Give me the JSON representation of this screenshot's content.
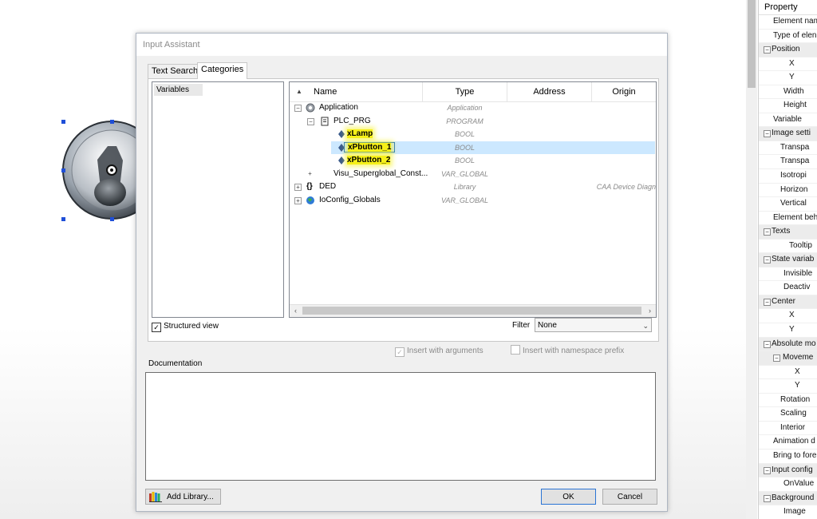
{
  "dialog": {
    "title": "Input Assistant",
    "tabs": [
      {
        "label": "Text Search",
        "active": false
      },
      {
        "label": "Categories",
        "active": true
      }
    ],
    "categories": [
      "Variables"
    ],
    "columns": {
      "name": "Name",
      "type": "Type",
      "address": "Address",
      "origin": "Origin"
    },
    "tree": [
      {
        "name": "Application",
        "type": "Application",
        "origin": ""
      },
      {
        "name": "PLC_PRG",
        "type": "PROGRAM",
        "origin": ""
      },
      {
        "name": "xLamp",
        "type": "BOOL",
        "origin": ""
      },
      {
        "name": "xPbutton_1",
        "type": "BOOL",
        "origin": ""
      },
      {
        "name": "xPbutton_2",
        "type": "BOOL",
        "origin": ""
      },
      {
        "name": "Visu_Superglobal_Const...",
        "type": "VAR_GLOBAL",
        "origin": ""
      },
      {
        "name": "DED",
        "type": "Library",
        "origin": "CAA Device Diagn"
      },
      {
        "name": "IoConfig_Globals",
        "type": "VAR_GLOBAL",
        "origin": ""
      }
    ],
    "structured_view_label": "Structured view",
    "filter_label": "Filter",
    "filter_value": "None",
    "insert_with_arguments": "Insert with arguments",
    "insert_with_namespace": "Insert with namespace prefix",
    "documentation_label": "Documentation",
    "add_library_label": "Add Library...",
    "ok_label": "OK",
    "cancel_label": "Cancel"
  },
  "property_grid": {
    "header": "Property",
    "rows": [
      {
        "label": "Element nam",
        "group": false
      },
      {
        "label": "Type of elen",
        "group": false
      },
      {
        "label": "Position",
        "group": true
      },
      {
        "label": "X",
        "group": false
      },
      {
        "label": "Y",
        "group": false
      },
      {
        "label": "Width",
        "group": false
      },
      {
        "label": "Height",
        "group": false
      },
      {
        "label": "Variable",
        "group": false
      },
      {
        "label": "Image setti",
        "group": true
      },
      {
        "label": "Transpa",
        "group": false
      },
      {
        "label": "Transpa",
        "group": false
      },
      {
        "label": "Isotropi",
        "group": false
      },
      {
        "label": "Horizon",
        "group": false
      },
      {
        "label": "Vertical",
        "group": false
      },
      {
        "label": "Element beh",
        "group": false
      },
      {
        "label": "Texts",
        "group": true
      },
      {
        "label": "Tooltip",
        "group": false
      },
      {
        "label": "State variab",
        "group": true
      },
      {
        "label": "Invisible",
        "group": false
      },
      {
        "label": "Deactiv",
        "group": false
      },
      {
        "label": "Center",
        "group": true
      },
      {
        "label": "X",
        "group": false
      },
      {
        "label": "Y",
        "group": false
      },
      {
        "label": "Absolute mo",
        "group": true
      },
      {
        "label": "Moveme",
        "group": true
      },
      {
        "label": "X",
        "group": false
      },
      {
        "label": "Y",
        "group": false
      },
      {
        "label": "Rotation",
        "group": false
      },
      {
        "label": "Scaling",
        "group": false
      },
      {
        "label": "Interior",
        "group": false
      },
      {
        "label": "Animation d",
        "group": false
      },
      {
        "label": "Bring to fore",
        "group": false
      },
      {
        "label": "Input config",
        "group": true
      },
      {
        "label": "OnValue",
        "group": false
      },
      {
        "label": "Background",
        "group": true
      },
      {
        "label": "Image",
        "group": false
      }
    ]
  }
}
